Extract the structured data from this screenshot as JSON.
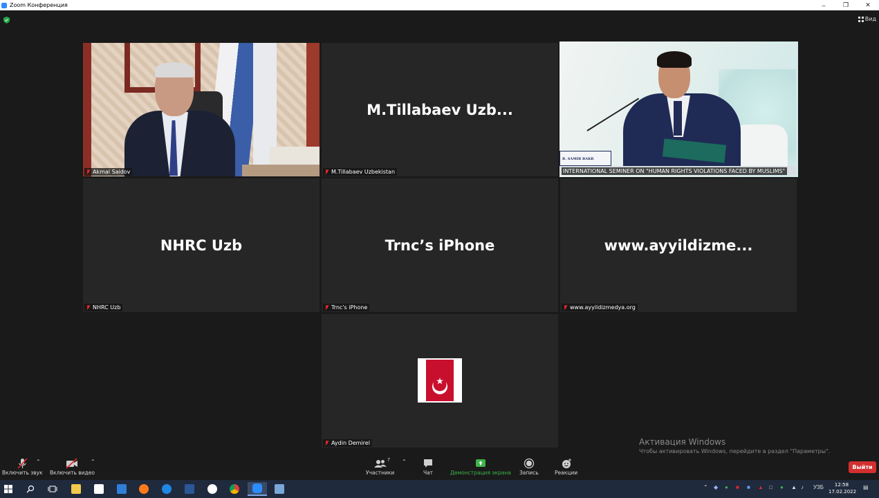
{
  "window": {
    "title": "Zoom Конференция"
  },
  "top_bar": {
    "view_label": "Вид"
  },
  "tiles": [
    {
      "name": "Akmal Saidov",
      "big_name": ""
    },
    {
      "name": "M.Tillabaev Uzbekistan",
      "big_name": "M.Tillabaev  Uzb..."
    },
    {
      "name": "INTERNATIONAL SEMINER ON \"HUMAN RIGHTS VIOLATIONS FACED BY MUSLIMS\"",
      "big_name": "",
      "plate": "B. SAMIR BAKR"
    },
    {
      "name": "NHRC Uzb",
      "big_name": "NHRC Uzb"
    },
    {
      "name": "Trnc's iPhone",
      "big_name": "Trnc’s iPhone"
    },
    {
      "name": "www.ayyildizmedya.org",
      "big_name": "www.ayyildizme..."
    },
    {
      "name": "Aydin Demirel",
      "big_name": ""
    }
  ],
  "watermark": {
    "title": "Активация Windows",
    "text": "Чтобы активировать Windows, перейдите в раздел \"Параметры\"."
  },
  "toolbar": {
    "unmute": "Включить звук",
    "start_video": "Включить видео",
    "participants": "Участники",
    "participants_count": "7",
    "chat": "Чат",
    "share": "Демонстрация экрана",
    "record": "Запись",
    "reactions": "Реакции",
    "leave": "Выйти"
  },
  "taskbar": {
    "lang": "УЗБ",
    "time": "12:58",
    "date": "17.02.2022"
  },
  "colors": {
    "active_speaker": "#e6e05a",
    "share_green": "#3cb44a",
    "leave_red": "#d32f2f",
    "muted_red": "#e02828"
  }
}
